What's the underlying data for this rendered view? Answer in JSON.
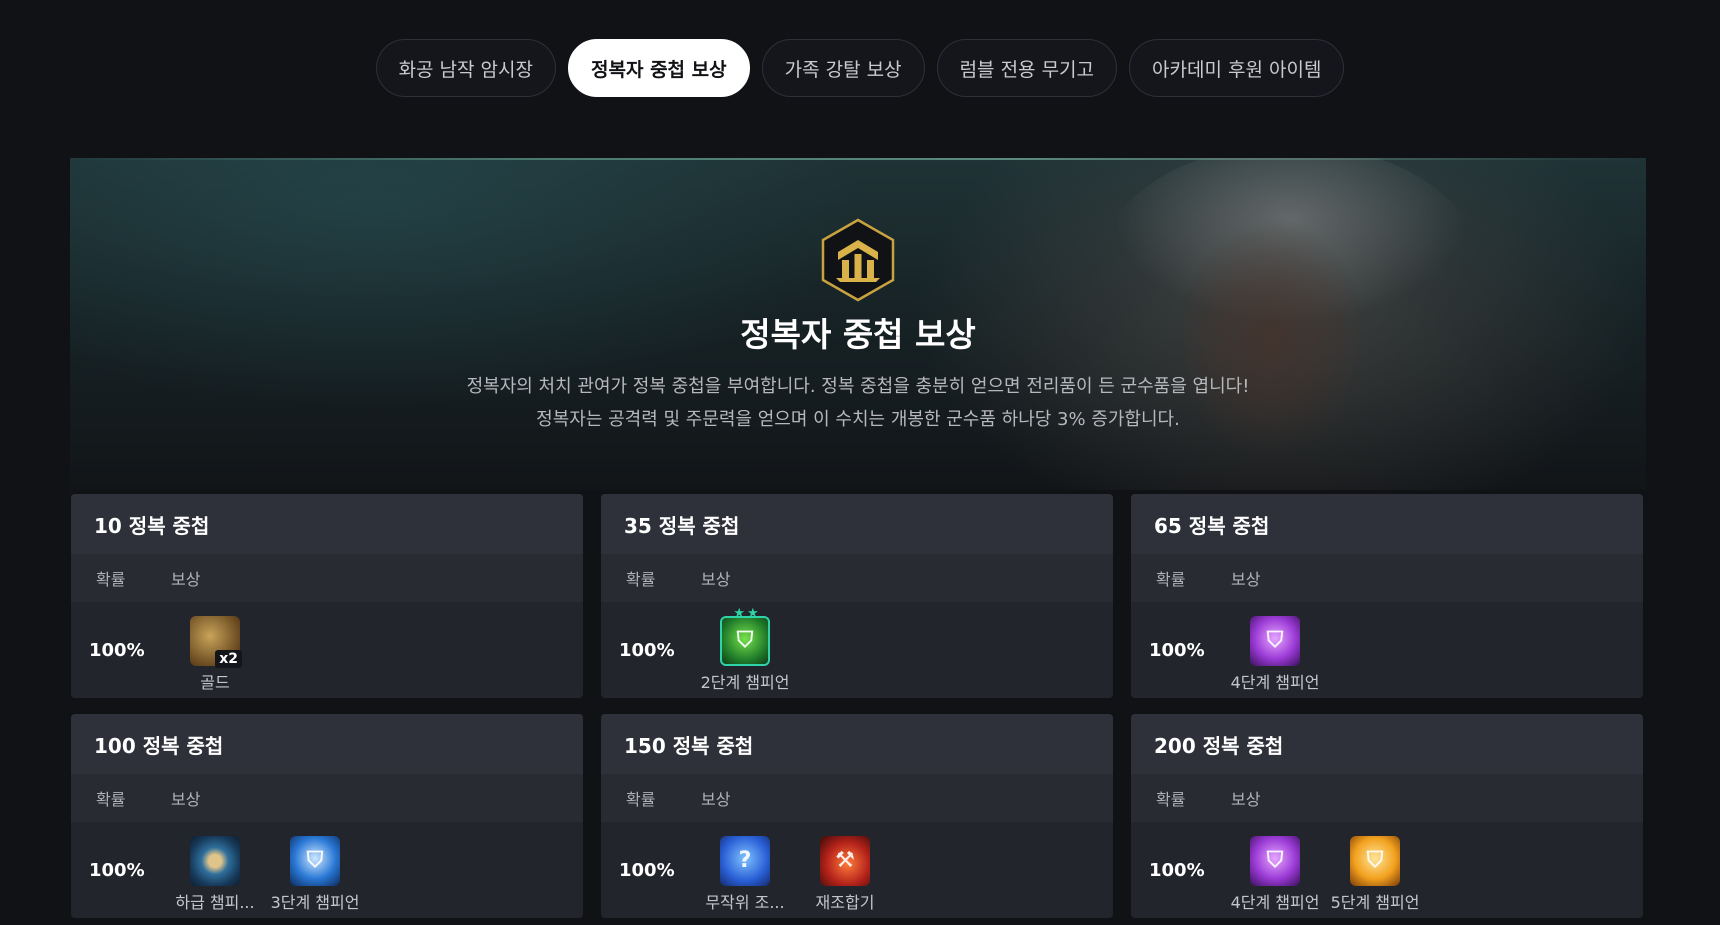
{
  "tabs": [
    {
      "label": "화공 남작 암시장",
      "active": false
    },
    {
      "label": "정복자 중첩 보상",
      "active": true
    },
    {
      "label": "가족 강탈 보상",
      "active": false
    },
    {
      "label": "럼블 전용 무기고",
      "active": false
    },
    {
      "label": "아카데미 후원 아이템",
      "active": false
    }
  ],
  "hero": {
    "title": "정복자 중첩 보상",
    "desc_line1": "정복자의 처치 관여가 정복 중첩을 부여합니다. 정복 중첩을 충분히 얻으면 전리품이 든 군수품을 엽니다!",
    "desc_line2": "정복자는 공격력 및 주문력을 얻으며 이 수치는 개봉한 군수품 하나당 3% 증가합니다.",
    "accent_color": "#d9b34a"
  },
  "col_labels": {
    "chance": "확률",
    "reward": "보상"
  },
  "cards": [
    {
      "title": "10 정복 중첩",
      "chance": "100%",
      "rewards": [
        {
          "label": "골드",
          "icon": "gold-icon",
          "badge": "x2"
        }
      ]
    },
    {
      "title": "35 정복 중첩",
      "chance": "100%",
      "rewards": [
        {
          "label": "2단계 챔피언",
          "icon": "tier2-champion-icon",
          "stars": "★★"
        }
      ]
    },
    {
      "title": "65 정복 중첩",
      "chance": "100%",
      "rewards": [
        {
          "label": "4단계 챔피언",
          "icon": "tier4-champion-icon"
        }
      ]
    },
    {
      "title": "100 정복 중첩",
      "chance": "100%",
      "rewards": [
        {
          "label": "하급 챔피...",
          "icon": "lesser-champion-orb-icon"
        },
        {
          "label": "3단계 챔피언",
          "icon": "tier3-champion-icon"
        }
      ]
    },
    {
      "title": "150 정복 중첩",
      "chance": "100%",
      "rewards": [
        {
          "label": "무작위 조...",
          "icon": "random-component-icon"
        },
        {
          "label": "재조합기",
          "icon": "reforger-icon"
        }
      ]
    },
    {
      "title": "200 정복 중첩",
      "chance": "100%",
      "rewards": [
        {
          "label": "4단계 챔피언",
          "icon": "tier4-champion-icon"
        },
        {
          "label": "5단계 챔피언",
          "icon": "tier5-champion-icon"
        }
      ]
    }
  ]
}
